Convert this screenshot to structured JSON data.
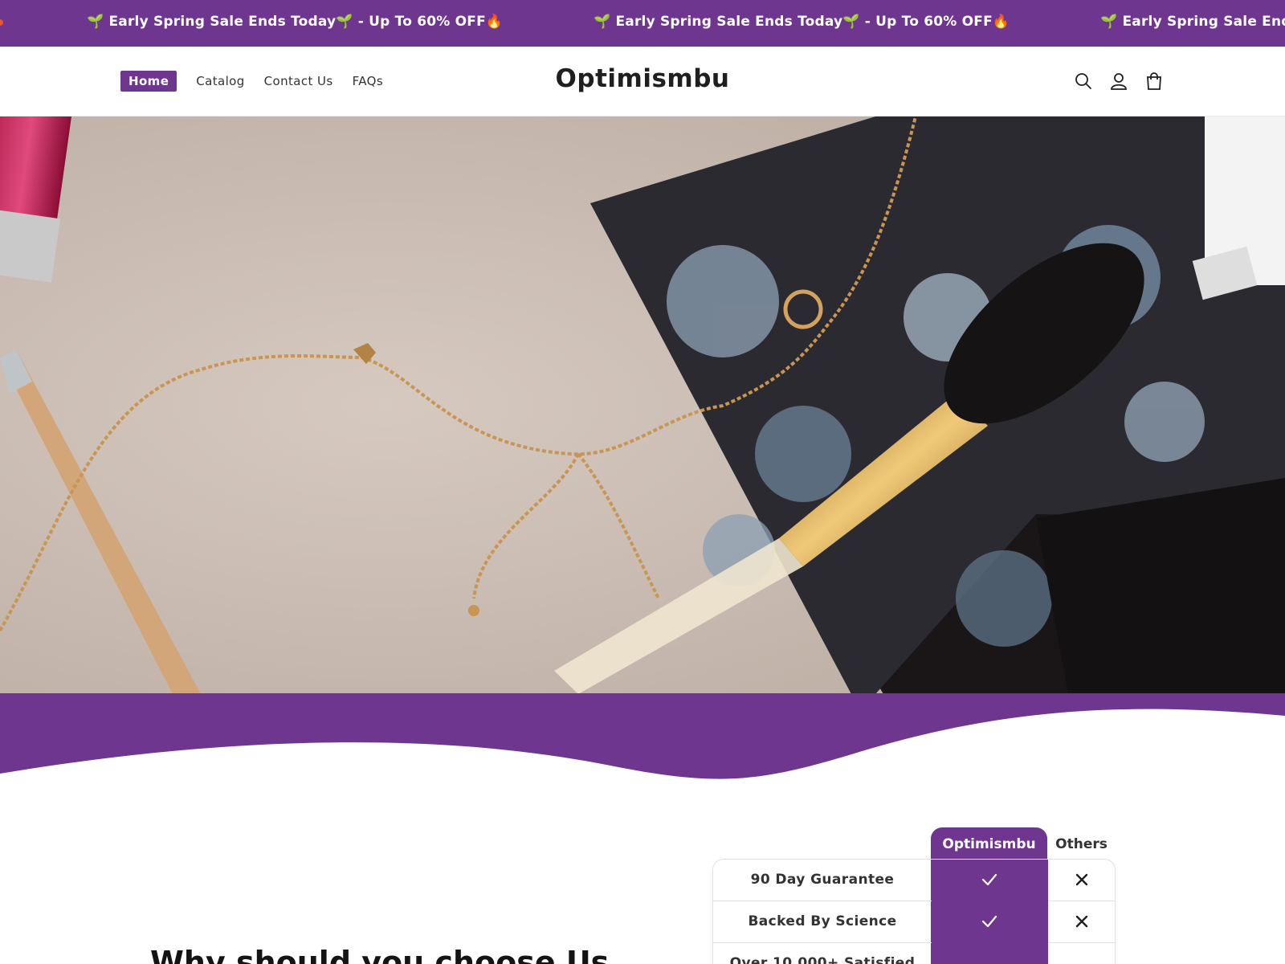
{
  "announcement": {
    "items": [
      "🌱 Early Spring Sale Ends Today🌱 - Up To 60% OFF🔥",
      "🌱 Early Spring Sale Ends Today🌱 - Up To 60% OFF🔥",
      "🌱 Early Spring Sale End"
    ]
  },
  "header": {
    "nav": [
      "Home",
      "Catalog",
      "Contact Us",
      "FAQs"
    ],
    "brand": "Optimismbu",
    "icons": [
      "search-icon",
      "account-icon",
      "cart-icon"
    ]
  },
  "colors": {
    "brand_purple": "#6e368e",
    "text_dark": "#1f1f1f"
  },
  "section": {
    "title": "Why should you choose Us"
  },
  "comparison": {
    "brand_column": "Optimismbu",
    "other_column": "Others",
    "rows": [
      {
        "label": "90 Day Guarantee",
        "brand": true,
        "others": false
      },
      {
        "label": "Backed By Science",
        "brand": true,
        "others": false
      },
      {
        "label": "Over 10,000+ Satisfied",
        "brand": true,
        "others": false
      }
    ]
  }
}
